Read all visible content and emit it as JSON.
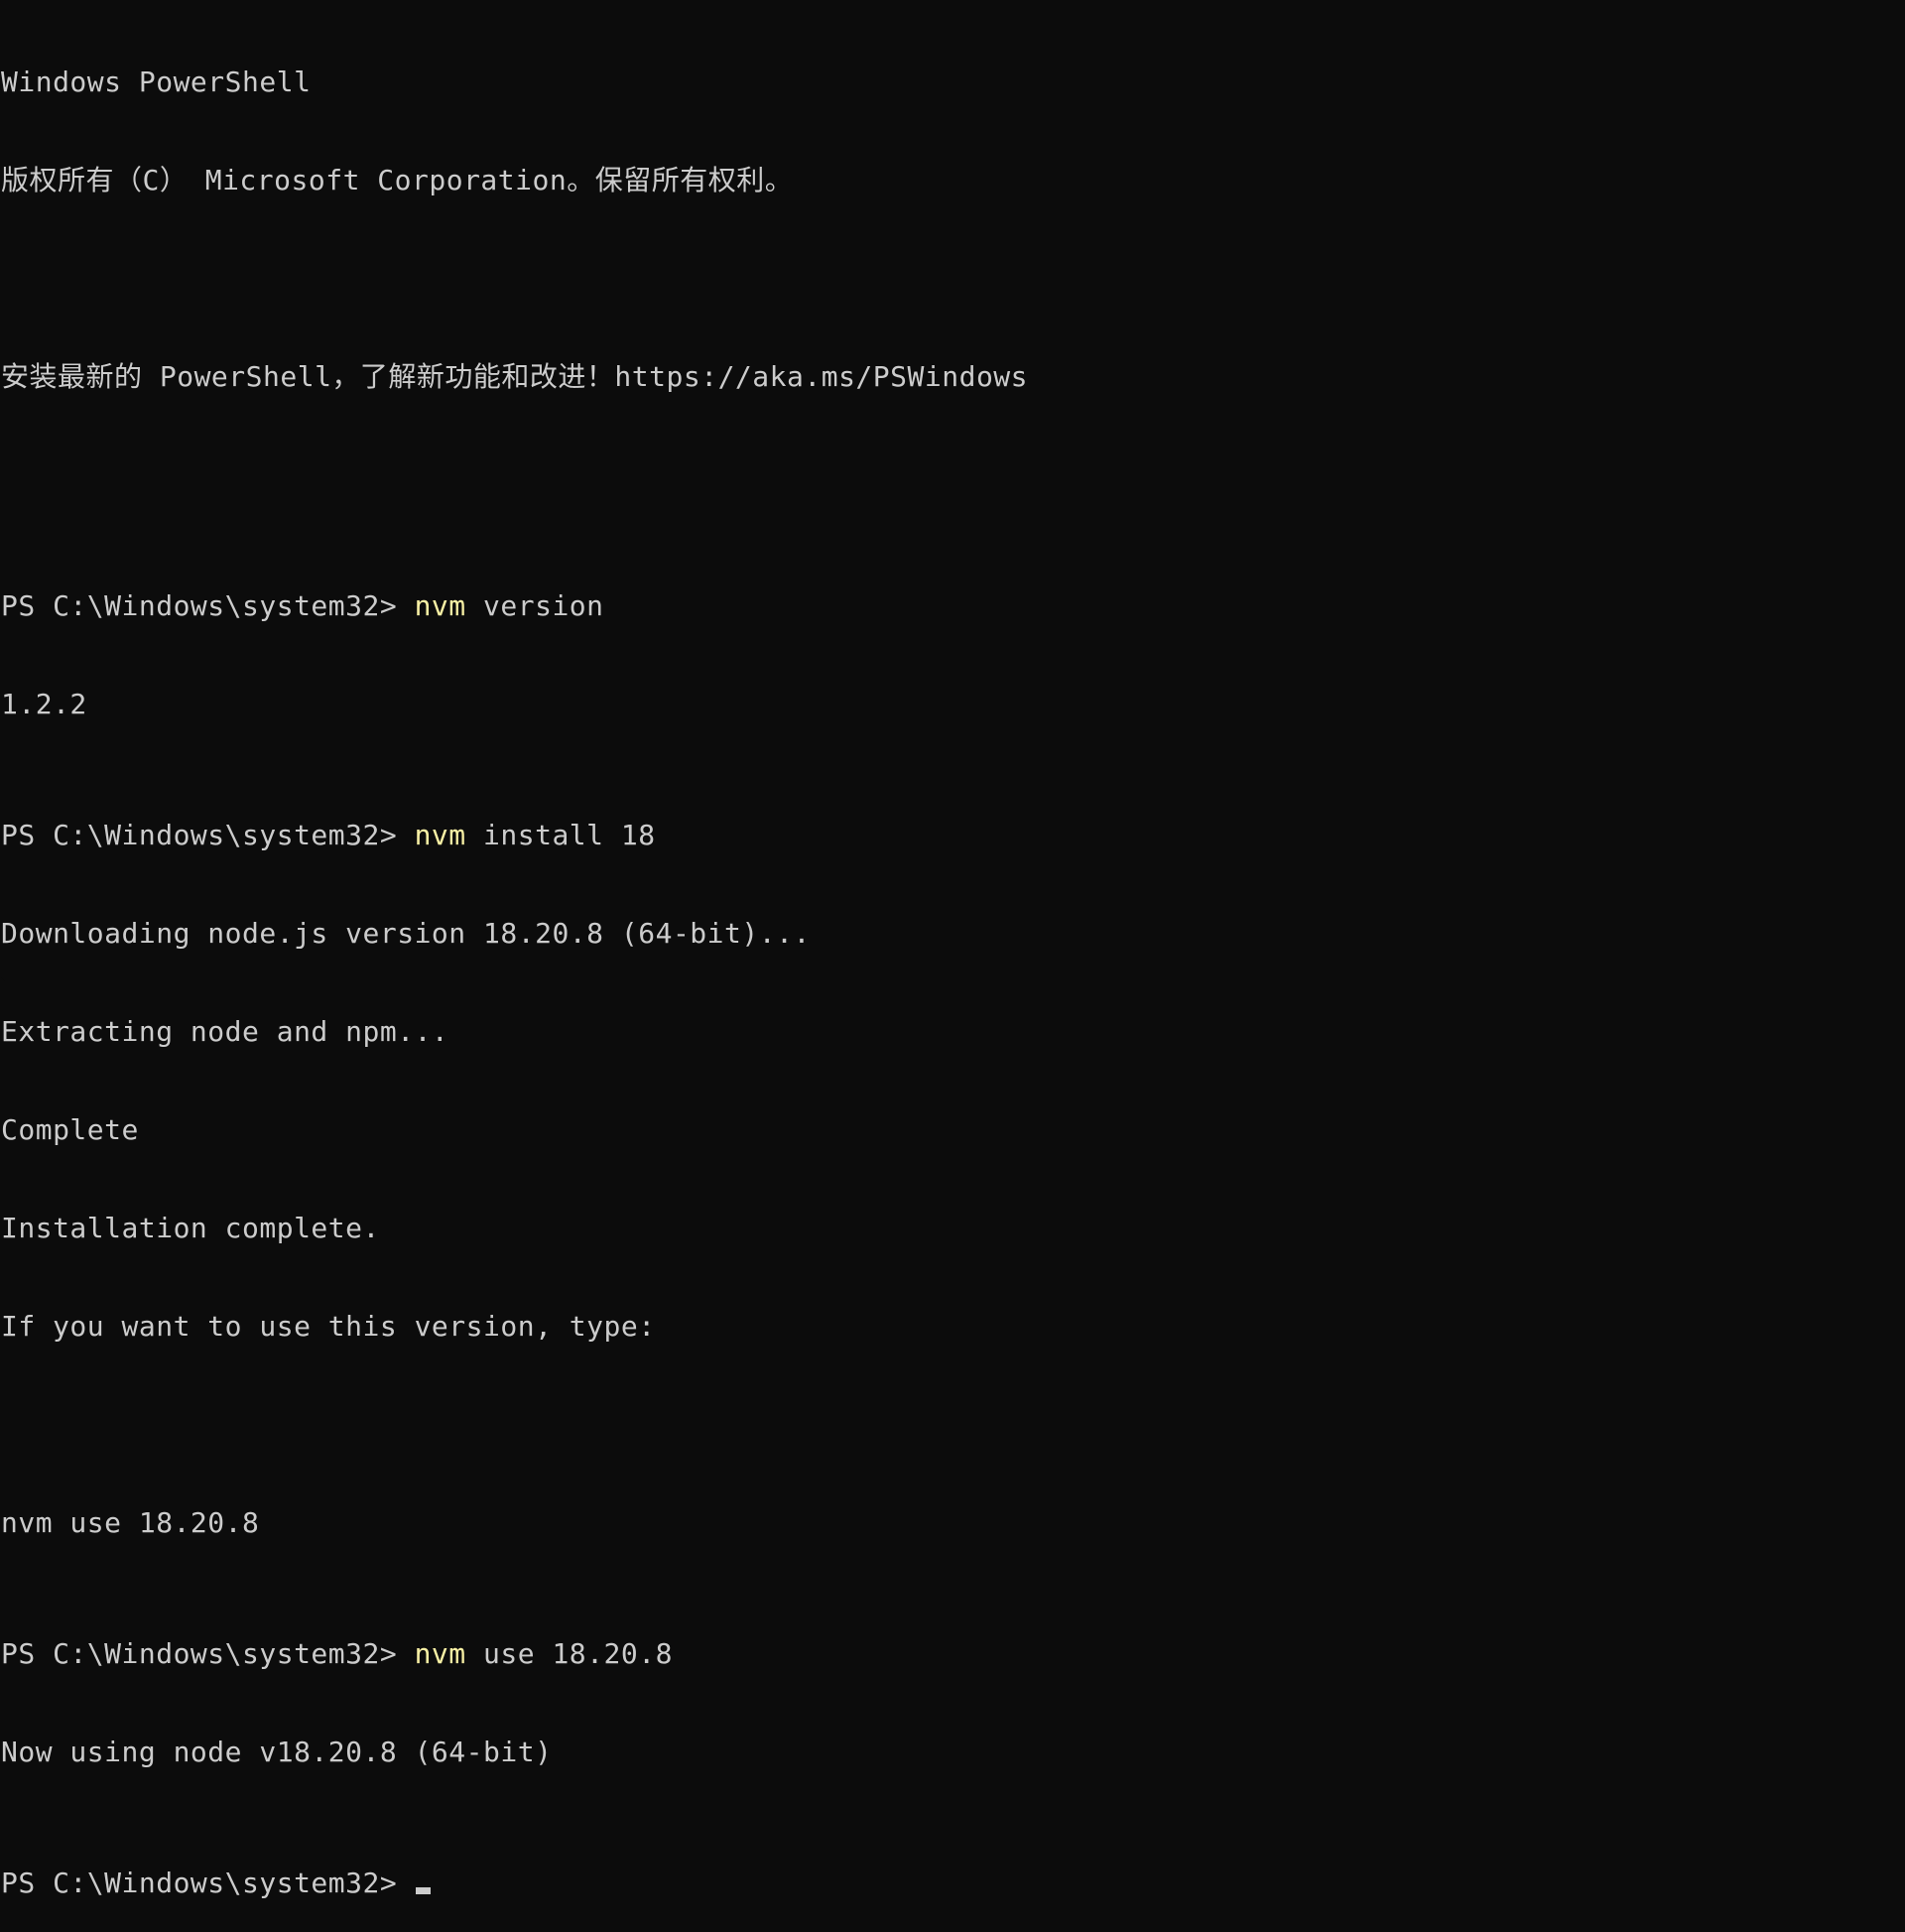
{
  "window_title": "Windows PowerShell",
  "colors": {
    "background": "#0c0c0c",
    "foreground": "#cccccc",
    "command": "#f9f1a5"
  },
  "lines": {
    "banner_title": "Windows PowerShell",
    "copyright": "版权所有（C） Microsoft Corporation。保留所有权利。",
    "upgrade_notice": "安装最新的 PowerShell，了解新功能和改进！https://aka.ms/PSWindows",
    "prompt": "PS C:\\Windows\\system32> ",
    "cmd1_name": "nvm",
    "cmd1_args": " version",
    "out_version": "1.2.2",
    "cmd2_name": "nvm",
    "cmd2_args": " install 18",
    "out_downloading": "Downloading node.js version 18.20.8 (64-bit)...",
    "out_extracting": "Extracting node and npm...",
    "out_complete": "Complete",
    "out_install_complete": "Installation complete.",
    "out_if_you_want": "If you want to use this version, type:",
    "out_nvm_use_hint": "nvm use 18.20.8",
    "cmd3_name": "nvm",
    "cmd3_args": " use 18.20.8",
    "out_now_using": "Now using node v18.20.8 (64-bit)"
  }
}
